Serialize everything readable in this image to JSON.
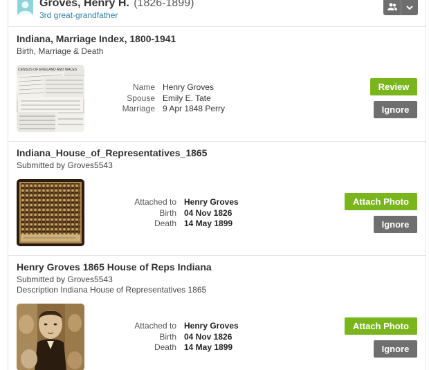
{
  "person": {
    "name": "Groves, Henry H.",
    "years": "(1826-1899)",
    "relationship": "3rd great-grandfather"
  },
  "records": [
    {
      "title": "Indiana, Marriage Index, 1800-1941",
      "subtitle": "Birth, Marriage & Death",
      "fields": [
        {
          "label": "Name",
          "value": "Henry Groves"
        },
        {
          "label": "Spouse",
          "value": "Emily E. Tate"
        },
        {
          "label": "Marriage",
          "value": "9 Apr 1848 Perry"
        }
      ],
      "primary_action": "Review",
      "secondary_action": "Ignore",
      "thumb_caption": "CENSUS OF ENGLAND AND WALES"
    },
    {
      "title": "Indiana_House_of_Representatives_1865",
      "subtitle": "Submitted by Groves5543",
      "fields": [
        {
          "label": "Attached to",
          "value": "Henry Groves"
        },
        {
          "label": "Birth",
          "value": "04 Nov 1826"
        },
        {
          "label": "Death",
          "value": "14 May 1899"
        }
      ],
      "primary_action": "Attach Photo",
      "secondary_action": "Ignore"
    },
    {
      "title": "Henry Groves 1865 House of Reps Indiana",
      "subtitle": "Submitted by Groves5543",
      "subtitle2": "Description Indiana House of Representatives 1865",
      "fields": [
        {
          "label": "Attached to",
          "value": "Henry Groves"
        },
        {
          "label": "Birth",
          "value": "04 Nov 1826"
        },
        {
          "label": "Death",
          "value": "14 May 1899"
        }
      ],
      "primary_action": "Attach Photo",
      "secondary_action": "Ignore"
    }
  ],
  "colors": {
    "accent_green": "#7ab51d",
    "button_gray": "#6f6f6f",
    "link_blue": "#2f7fa3",
    "avatar_teal": "#8fd3dc"
  },
  "icons": {
    "header_people": "people-icon",
    "header_dropdown": "chevron-down-icon"
  }
}
